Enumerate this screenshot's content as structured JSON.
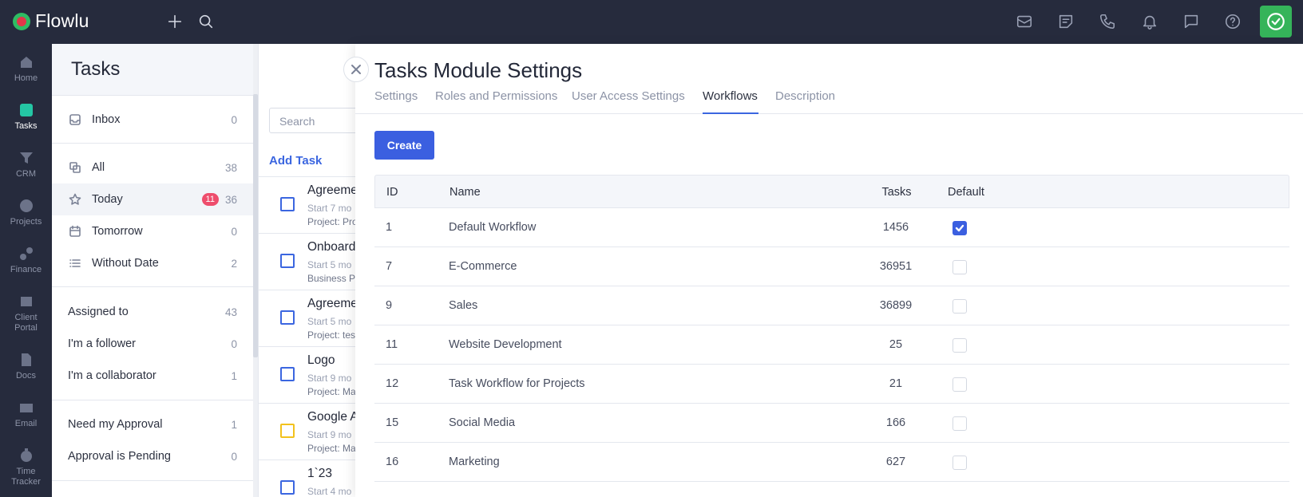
{
  "app": {
    "name": "Flowlu"
  },
  "topbar": {
    "icons": [
      "plus-icon",
      "search-icon",
      "mail-icon",
      "notes-icon",
      "phone-icon",
      "bell-icon",
      "chat-icon",
      "help-icon",
      "check-badge-icon"
    ]
  },
  "rail": {
    "items": [
      {
        "label": "Home",
        "active": false
      },
      {
        "label": "Tasks",
        "active": true
      },
      {
        "label": "CRM",
        "active": false
      },
      {
        "label": "Projects",
        "active": false
      },
      {
        "label": "Finance",
        "active": false
      },
      {
        "label": "Client Portal",
        "active": false
      },
      {
        "label": "Docs",
        "active": false
      },
      {
        "label": "Email",
        "active": false
      },
      {
        "label": "Time Tracker",
        "active": false
      }
    ]
  },
  "lists": {
    "title": "Tasks",
    "inbox": {
      "label": "Inbox",
      "count": "0"
    },
    "all": {
      "label": "All",
      "count": "38"
    },
    "today": {
      "label": "Today",
      "hot": "11",
      "count": "36"
    },
    "tomorrow": {
      "label": "Tomorrow",
      "count": "0"
    },
    "without_date": {
      "label": "Without Date",
      "count": "2"
    },
    "assigned": {
      "label": "Assigned to",
      "count": "43"
    },
    "follower": {
      "label": "I'm a follower",
      "count": "0"
    },
    "collaborator": {
      "label": "I'm a collaborator",
      "count": "1"
    },
    "need_approval": {
      "label": "Need my Approval",
      "count": "1"
    },
    "approval_pending": {
      "label": "Approval is Pending",
      "count": "0"
    }
  },
  "taskcol": {
    "search_placeholder": "Search",
    "add_task": "Add Task",
    "tasks": [
      {
        "title": "Agreeme",
        "start": "Start 7 mo",
        "project": "Project: Pro",
        "color": "blue"
      },
      {
        "title": "Onboard",
        "start": "Start 5 mo",
        "project": "Business P",
        "color": "blue"
      },
      {
        "title": "Agreeme",
        "start": "Start 5 mo",
        "project": "Project: tes",
        "color": "blue"
      },
      {
        "title": "Logo",
        "start": "Start 9 mo",
        "project": "Project: Ma",
        "color": "blue"
      },
      {
        "title": "Google A",
        "start": "Start 9 mo",
        "project": "Project: Ma",
        "color": "yellow"
      },
      {
        "title": "1`23",
        "start": "Start 4 mo",
        "project": "",
        "color": "blue"
      }
    ]
  },
  "settings": {
    "title": "Tasks Module Settings",
    "tabs": [
      "Settings",
      "Roles and Permissions",
      "User Access Settings",
      "Workflows",
      "Description"
    ],
    "active_tab": "Workflows",
    "create_label": "Create",
    "table": {
      "headers": {
        "id": "ID",
        "name": "Name",
        "tasks": "Tasks",
        "default": "Default"
      },
      "rows": [
        {
          "id": "1",
          "name": "Default Workflow",
          "tasks": "1456",
          "default": true
        },
        {
          "id": "7",
          "name": "E-Commerce",
          "tasks": "36951",
          "default": false
        },
        {
          "id": "9",
          "name": "Sales",
          "tasks": "36899",
          "default": false
        },
        {
          "id": "11",
          "name": "Website Development",
          "tasks": "25",
          "default": false
        },
        {
          "id": "12",
          "name": "Task Workflow for Projects",
          "tasks": "21",
          "default": false
        },
        {
          "id": "15",
          "name": "Social Media",
          "tasks": "166",
          "default": false
        },
        {
          "id": "16",
          "name": "Marketing",
          "tasks": "627",
          "default": false
        }
      ]
    }
  },
  "colors": {
    "accent": "#3b5fe0",
    "sidebar": "#262b3d",
    "success": "#35b45a",
    "hot": "#ee4d6c"
  }
}
